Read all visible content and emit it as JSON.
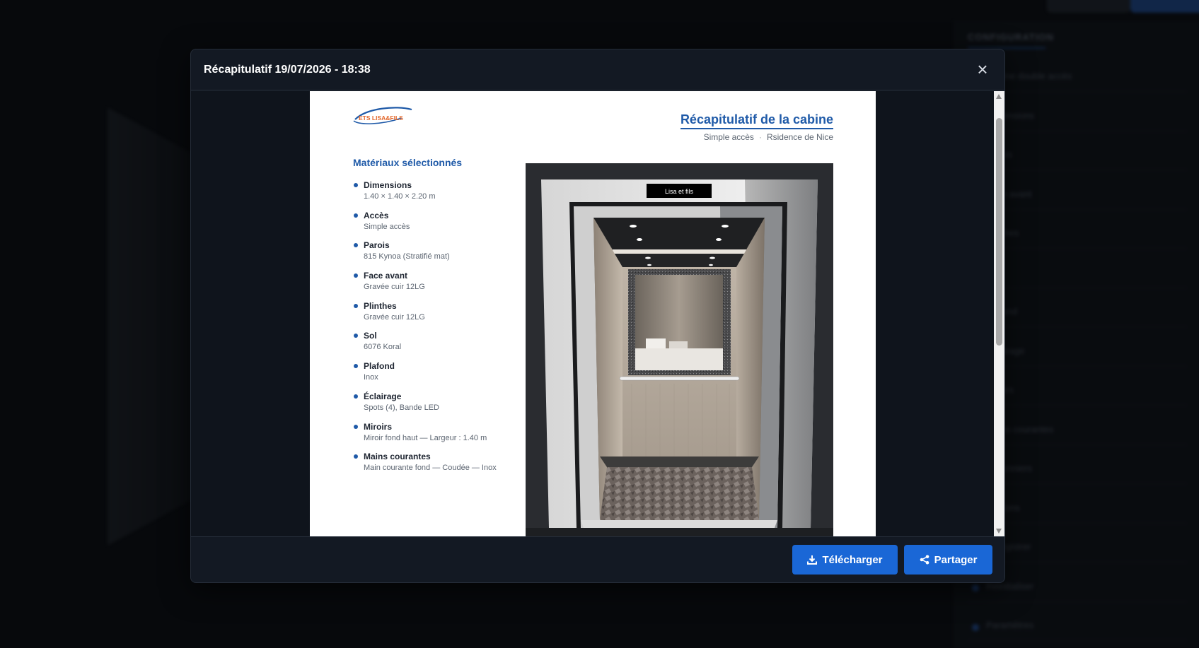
{
  "background": {
    "sidebar_title": "CONFIGURATION",
    "sidebar_items": [
      "Cabine double accès",
      "Dimensions",
      "Parois",
      "Face avant",
      "Plinthes",
      "Sol",
      "Plafond",
      "Éclairage",
      "Miroirs",
      "Mains courantes",
      "Plafonniers",
      "Boutons",
      "Enregistrer",
      "Réinitialiser",
      "Paramètres"
    ]
  },
  "modal": {
    "title": "Récapitulatif 19/07/2026 - 18:38",
    "close_label": "×"
  },
  "document": {
    "logo_text": "ETS LISA&FILS",
    "title": "Récapitulatif de la cabine",
    "subtitle_access": "Simple accès",
    "subtitle_site": "Rsidence de Nice",
    "materials_heading": "Matériaux sélectionnés",
    "materials": [
      {
        "label": "Dimensions",
        "value": "1.40 × 1.40 × 2.20 m"
      },
      {
        "label": "Accès",
        "value": "Simple accès"
      },
      {
        "label": "Parois",
        "value": "815 Kynoa (Stratifié mat)"
      },
      {
        "label": "Face avant",
        "value": "Gravée cuir 12LG"
      },
      {
        "label": "Plinthes",
        "value": "Gravée cuir 12LG"
      },
      {
        "label": "Sol",
        "value": "6076 Koral"
      },
      {
        "label": "Plafond",
        "value": "Inox"
      },
      {
        "label": "Éclairage",
        "value": "Spots (4), Bande LED"
      },
      {
        "label": "Miroirs",
        "value": "Miroir fond haut — Largeur : 1.40 m"
      },
      {
        "label": "Mains courantes",
        "value": "Main courante fond — Coudée — Inox"
      }
    ],
    "cabin_sign": "Lisa et fils"
  },
  "footer": {
    "download_label": "Télécharger",
    "share_label": "Partager"
  },
  "colors": {
    "accent": "#1a67d6",
    "heading_blue": "#1f5aa8"
  }
}
